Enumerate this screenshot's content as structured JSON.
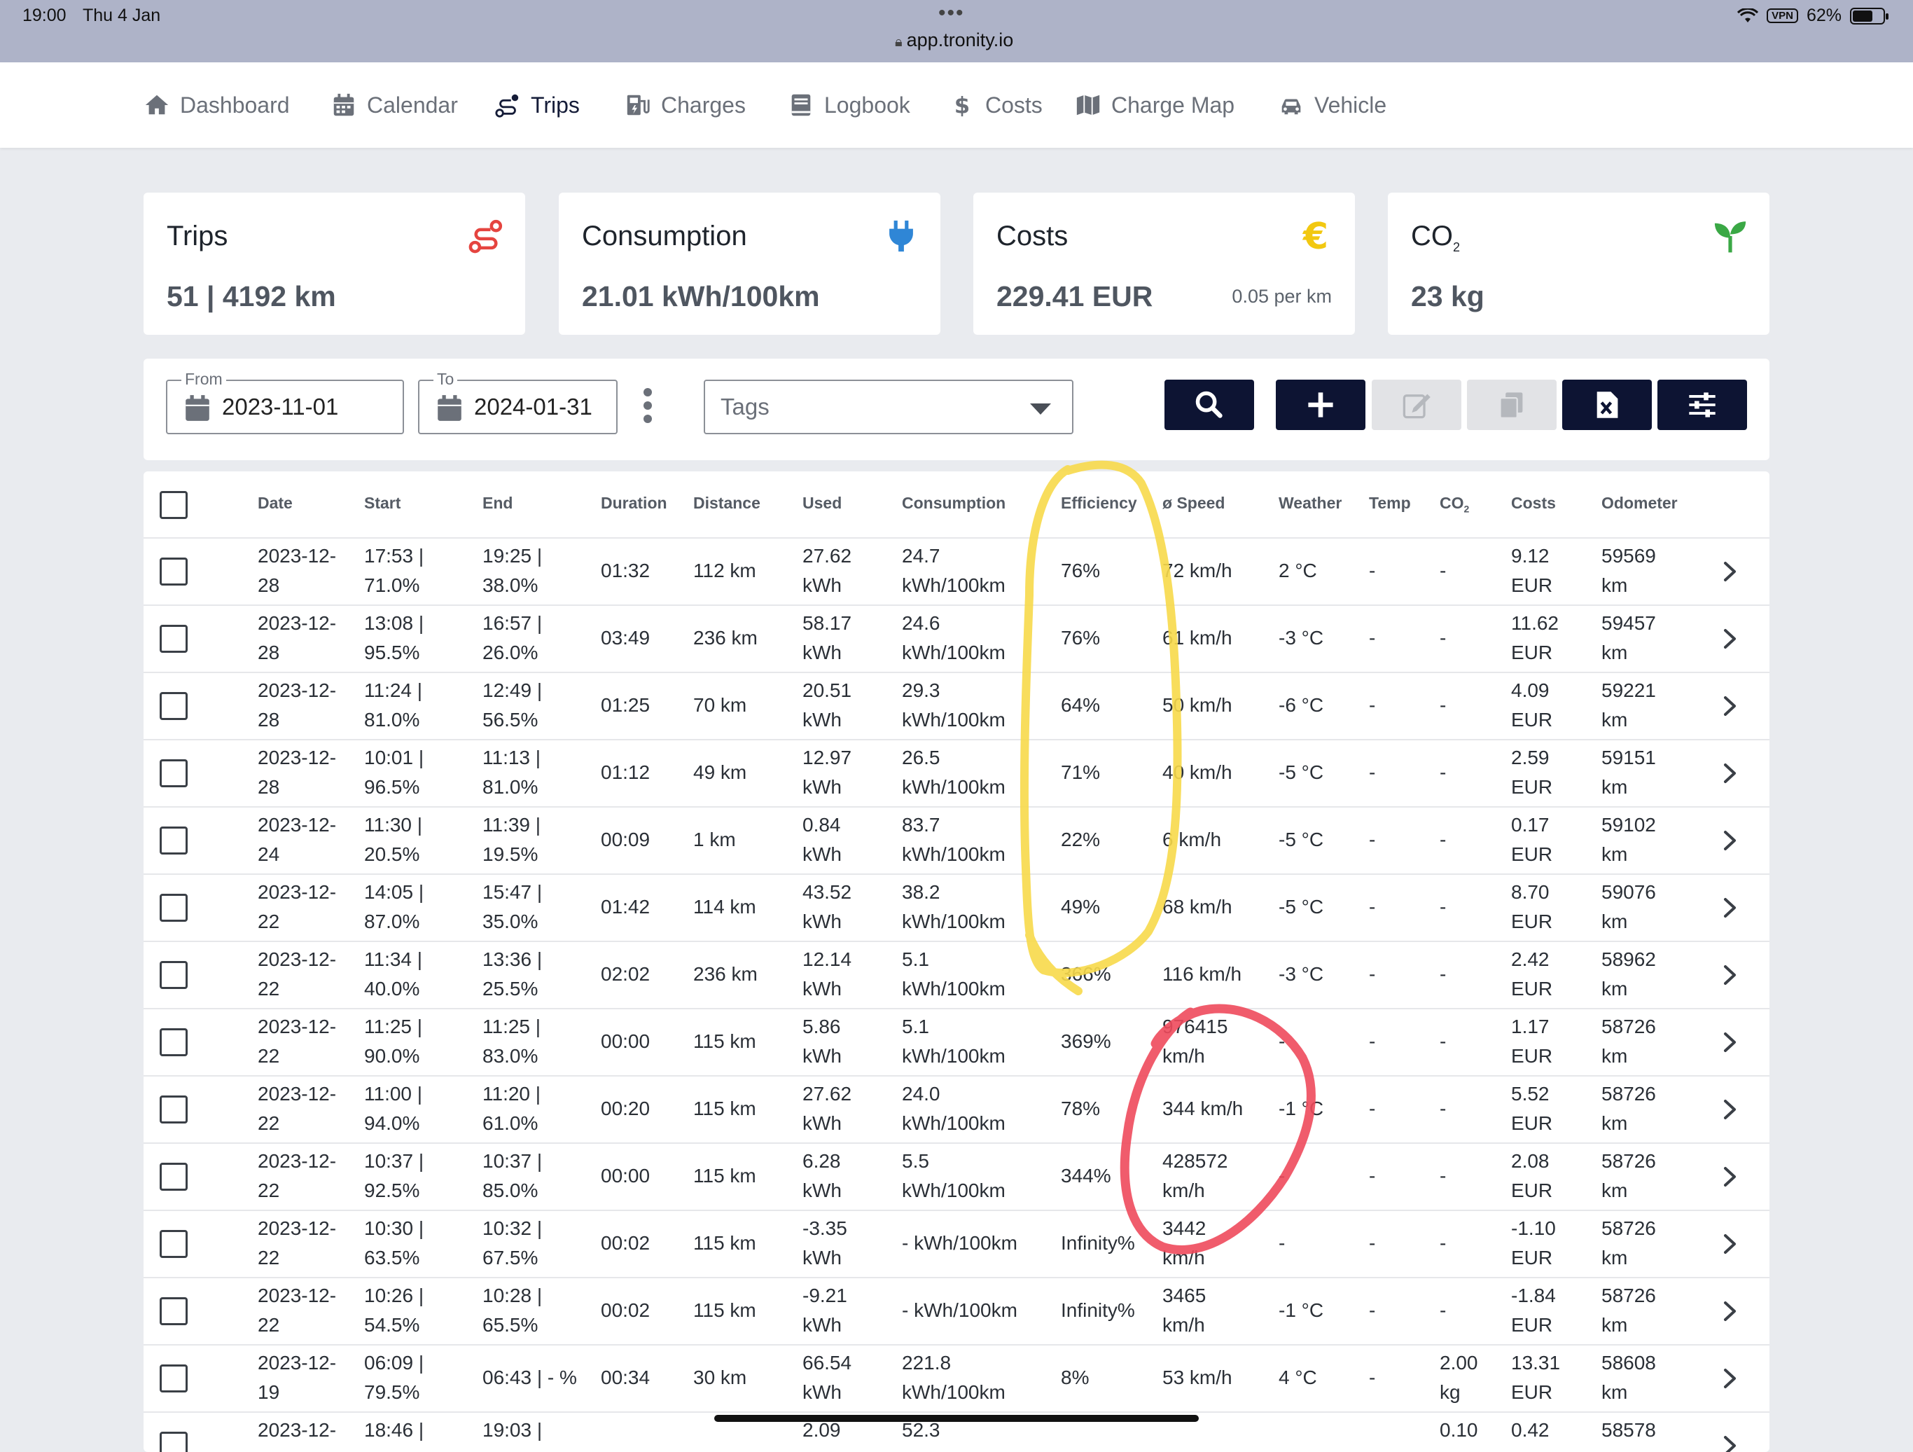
{
  "status": {
    "time": "19:00",
    "date": "Thu 4 Jan",
    "url": "app.tronity.io",
    "vpn": "VPN",
    "battery": "62%"
  },
  "nav": {
    "items": [
      {
        "label": "Dashboard",
        "icon": "home-icon"
      },
      {
        "label": "Calendar",
        "icon": "calendar-icon"
      },
      {
        "label": "Trips",
        "icon": "route-icon",
        "active": true
      },
      {
        "label": "Charges",
        "icon": "charging-station-icon"
      },
      {
        "label": "Logbook",
        "icon": "book-icon"
      },
      {
        "label": "Costs",
        "icon": "dollar-icon"
      },
      {
        "label": "Charge Map",
        "icon": "map-icon"
      },
      {
        "label": "Vehicle",
        "icon": "car-icon"
      }
    ]
  },
  "cards": {
    "trips": {
      "title": "Trips",
      "value": "51 | 4192 km",
      "icon": "route-icon",
      "color": "#e5443f"
    },
    "consumption": {
      "title": "Consumption",
      "value": "21.01 kWh/100km",
      "icon": "plug-icon",
      "color": "#2f86d6"
    },
    "costs": {
      "title": "Costs",
      "value": "229.41 EUR",
      "sub": "0.05 per km",
      "icon": "euro-icon",
      "color": "#f2c811"
    },
    "co2": {
      "title": "CO",
      "title_sub": "2",
      "value": "23 kg",
      "icon": "sprout-icon",
      "color": "#3aa845"
    }
  },
  "filters": {
    "from_label": "From",
    "from_value": "2023-11-01",
    "to_label": "To",
    "to_value": "2024-01-31",
    "tags_placeholder": "Tags"
  },
  "colors": {
    "navy": "#0d1433",
    "highlight_yellow": "#f7d94a",
    "highlight_red": "#ee4a5c"
  },
  "table": {
    "headers": [
      "Date",
      "Start",
      "End",
      "Duration",
      "Distance",
      "Used",
      "Consumption",
      "Efficiency",
      "ø Speed",
      "Weather",
      "Temp",
      "CO",
      "Costs",
      "Odometer"
    ],
    "co2_sub": "2",
    "rows": [
      {
        "date": [
          "2023-12-",
          "28"
        ],
        "start": [
          "17:53 |",
          "71.0%"
        ],
        "end": [
          "19:25 |",
          "38.0%"
        ],
        "duration": "01:32",
        "distance": "112 km",
        "used": [
          "27.62",
          "kWh"
        ],
        "consumption": [
          "24.7",
          "kWh/100km"
        ],
        "efficiency": "76%",
        "speed": [
          "72 km/h"
        ],
        "weather": "2 °C",
        "temp": "-",
        "co2": [
          "-"
        ],
        "costs": [
          "9.12",
          "EUR"
        ],
        "odometer": [
          "59569",
          "km"
        ]
      },
      {
        "date": [
          "2023-12-",
          "28"
        ],
        "start": [
          "13:08 |",
          "95.5%"
        ],
        "end": [
          "16:57 |",
          "26.0%"
        ],
        "duration": "03:49",
        "distance": "236 km",
        "used": [
          "58.17",
          "kWh"
        ],
        "consumption": [
          "24.6",
          "kWh/100km"
        ],
        "efficiency": "76%",
        "speed": [
          "61 km/h"
        ],
        "weather": "-3 °C",
        "temp": "-",
        "co2": [
          "-"
        ],
        "costs": [
          "11.62",
          "EUR"
        ],
        "odometer": [
          "59457",
          "km"
        ]
      },
      {
        "date": [
          "2023-12-",
          "28"
        ],
        "start": [
          "11:24 |",
          "81.0%"
        ],
        "end": [
          "12:49 |",
          "56.5%"
        ],
        "duration": "01:25",
        "distance": "70 km",
        "used": [
          "20.51",
          "kWh"
        ],
        "consumption": [
          "29.3",
          "kWh/100km"
        ],
        "efficiency": "64%",
        "speed": [
          "50 km/h"
        ],
        "weather": "-6 °C",
        "temp": "-",
        "co2": [
          "-"
        ],
        "costs": [
          "4.09",
          "EUR"
        ],
        "odometer": [
          "59221",
          "km"
        ]
      },
      {
        "date": [
          "2023-12-",
          "28"
        ],
        "start": [
          "10:01 |",
          "96.5%"
        ],
        "end": [
          "11:13 |",
          "81.0%"
        ],
        "duration": "01:12",
        "distance": "49 km",
        "used": [
          "12.97",
          "kWh"
        ],
        "consumption": [
          "26.5",
          "kWh/100km"
        ],
        "efficiency": "71%",
        "speed": [
          "40 km/h"
        ],
        "weather": "-5 °C",
        "temp": "-",
        "co2": [
          "-"
        ],
        "costs": [
          "2.59",
          "EUR"
        ],
        "odometer": [
          "59151",
          "km"
        ]
      },
      {
        "date": [
          "2023-12-",
          "24"
        ],
        "start": [
          "11:30 |",
          "20.5%"
        ],
        "end": [
          "11:39 |",
          "19.5%"
        ],
        "duration": "00:09",
        "distance": "1 km",
        "used": [
          "0.84",
          "kWh"
        ],
        "consumption": [
          "83.7",
          "kWh/100km"
        ],
        "efficiency": "22%",
        "speed": [
          "6 km/h"
        ],
        "weather": "-5 °C",
        "temp": "-",
        "co2": [
          "-"
        ],
        "costs": [
          "0.17",
          "EUR"
        ],
        "odometer": [
          "59102",
          "km"
        ]
      },
      {
        "date": [
          "2023-12-",
          "22"
        ],
        "start": [
          "14:05 |",
          "87.0%"
        ],
        "end": [
          "15:47 |",
          "35.0%"
        ],
        "duration": "01:42",
        "distance": "114 km",
        "used": [
          "43.52",
          "kWh"
        ],
        "consumption": [
          "38.2",
          "kWh/100km"
        ],
        "efficiency": "49%",
        "speed": [
          "68 km/h"
        ],
        "weather": "-5 °C",
        "temp": "-",
        "co2": [
          "-"
        ],
        "costs": [
          "8.70",
          "EUR"
        ],
        "odometer": [
          "59076",
          "km"
        ]
      },
      {
        "date": [
          "2023-12-",
          "22"
        ],
        "start": [
          "11:34 |",
          "40.0%"
        ],
        "end": [
          "13:36 |",
          "25.5%"
        ],
        "duration": "02:02",
        "distance": "236 km",
        "used": [
          "12.14",
          "kWh"
        ],
        "consumption": [
          "5.1",
          "kWh/100km"
        ],
        "efficiency": "366%",
        "speed": [
          "116 km/h"
        ],
        "weather": "-3 °C",
        "temp": "-",
        "co2": [
          "-"
        ],
        "costs": [
          "2.42",
          "EUR"
        ],
        "odometer": [
          "58962",
          "km"
        ]
      },
      {
        "date": [
          "2023-12-",
          "22"
        ],
        "start": [
          "11:25 |",
          "90.0%"
        ],
        "end": [
          "11:25 |",
          "83.0%"
        ],
        "duration": "00:00",
        "distance": "115 km",
        "used": [
          "5.86",
          "kWh"
        ],
        "consumption": [
          "5.1",
          "kWh/100km"
        ],
        "efficiency": "369%",
        "speed": [
          "976415",
          "km/h"
        ],
        "weather": "-",
        "temp": "-",
        "co2": [
          "-"
        ],
        "costs": [
          "1.17",
          "EUR"
        ],
        "odometer": [
          "58726",
          "km"
        ]
      },
      {
        "date": [
          "2023-12-",
          "22"
        ],
        "start": [
          "11:00 |",
          "94.0%"
        ],
        "end": [
          "11:20 |",
          "61.0%"
        ],
        "duration": "00:20",
        "distance": "115 km",
        "used": [
          "27.62",
          "kWh"
        ],
        "consumption": [
          "24.0",
          "kWh/100km"
        ],
        "efficiency": "78%",
        "speed": [
          "344 km/h"
        ],
        "weather": "-1 °C",
        "temp": "-",
        "co2": [
          "-"
        ],
        "costs": [
          "5.52",
          "EUR"
        ],
        "odometer": [
          "58726",
          "km"
        ]
      },
      {
        "date": [
          "2023-12-",
          "22"
        ],
        "start": [
          "10:37 |",
          "92.5%"
        ],
        "end": [
          "10:37 |",
          "85.0%"
        ],
        "duration": "00:00",
        "distance": "115 km",
        "used": [
          "6.28",
          "kWh"
        ],
        "consumption": [
          "5.5",
          "kWh/100km"
        ],
        "efficiency": "344%",
        "speed": [
          "428572",
          "km/h"
        ],
        "weather": "-",
        "temp": "-",
        "co2": [
          "-"
        ],
        "costs": [
          "2.08",
          "EUR"
        ],
        "odometer": [
          "58726",
          "km"
        ]
      },
      {
        "date": [
          "2023-12-",
          "22"
        ],
        "start": [
          "10:30 |",
          "63.5%"
        ],
        "end": [
          "10:32 |",
          "67.5%"
        ],
        "duration": "00:02",
        "distance": "115 km",
        "used": [
          "-3.35",
          "kWh"
        ],
        "consumption": [
          "- kWh/100km"
        ],
        "efficiency": "Infinity%",
        "speed": [
          "3442",
          "km/h"
        ],
        "weather": "-",
        "temp": "-",
        "co2": [
          "-"
        ],
        "costs": [
          "-1.10",
          "EUR"
        ],
        "odometer": [
          "58726",
          "km"
        ]
      },
      {
        "date": [
          "2023-12-",
          "22"
        ],
        "start": [
          "10:26 |",
          "54.5%"
        ],
        "end": [
          "10:28 |",
          "65.5%"
        ],
        "duration": "00:02",
        "distance": "115 km",
        "used": [
          "-9.21",
          "kWh"
        ],
        "consumption": [
          "- kWh/100km"
        ],
        "efficiency": "Infinity%",
        "speed": [
          "3465",
          "km/h"
        ],
        "weather": "-1 °C",
        "temp": "-",
        "co2": [
          "-"
        ],
        "costs": [
          "-1.84",
          "EUR"
        ],
        "odometer": [
          "58726",
          "km"
        ]
      },
      {
        "date": [
          "2023-12-",
          "19"
        ],
        "start": [
          "06:09 |",
          "79.5%"
        ],
        "end": [
          "06:43 | - %"
        ],
        "duration": "00:34",
        "distance": "30 km",
        "used": [
          "66.54",
          "kWh"
        ],
        "consumption": [
          "221.8",
          "kWh/100km"
        ],
        "efficiency": "8%",
        "speed": [
          "53 km/h"
        ],
        "weather": "4 °C",
        "temp": "-",
        "co2": [
          "2.00",
          "kg"
        ],
        "costs": [
          "13.31",
          "EUR"
        ],
        "odometer": [
          "58608",
          "km"
        ]
      },
      {
        "date": [
          "2023-12-",
          ""
        ],
        "start": [
          "18:46 |",
          ""
        ],
        "end": [
          "19:03 |",
          ""
        ],
        "duration": "",
        "distance": "",
        "used": [
          "2.09",
          ""
        ],
        "consumption": [
          "52.3",
          ""
        ],
        "efficiency": "",
        "speed": [
          ""
        ],
        "weather": "",
        "temp": "",
        "co2": [
          "0.10",
          ""
        ],
        "costs": [
          "0.42",
          ""
        ],
        "odometer": [
          "58578",
          ""
        ]
      }
    ]
  }
}
